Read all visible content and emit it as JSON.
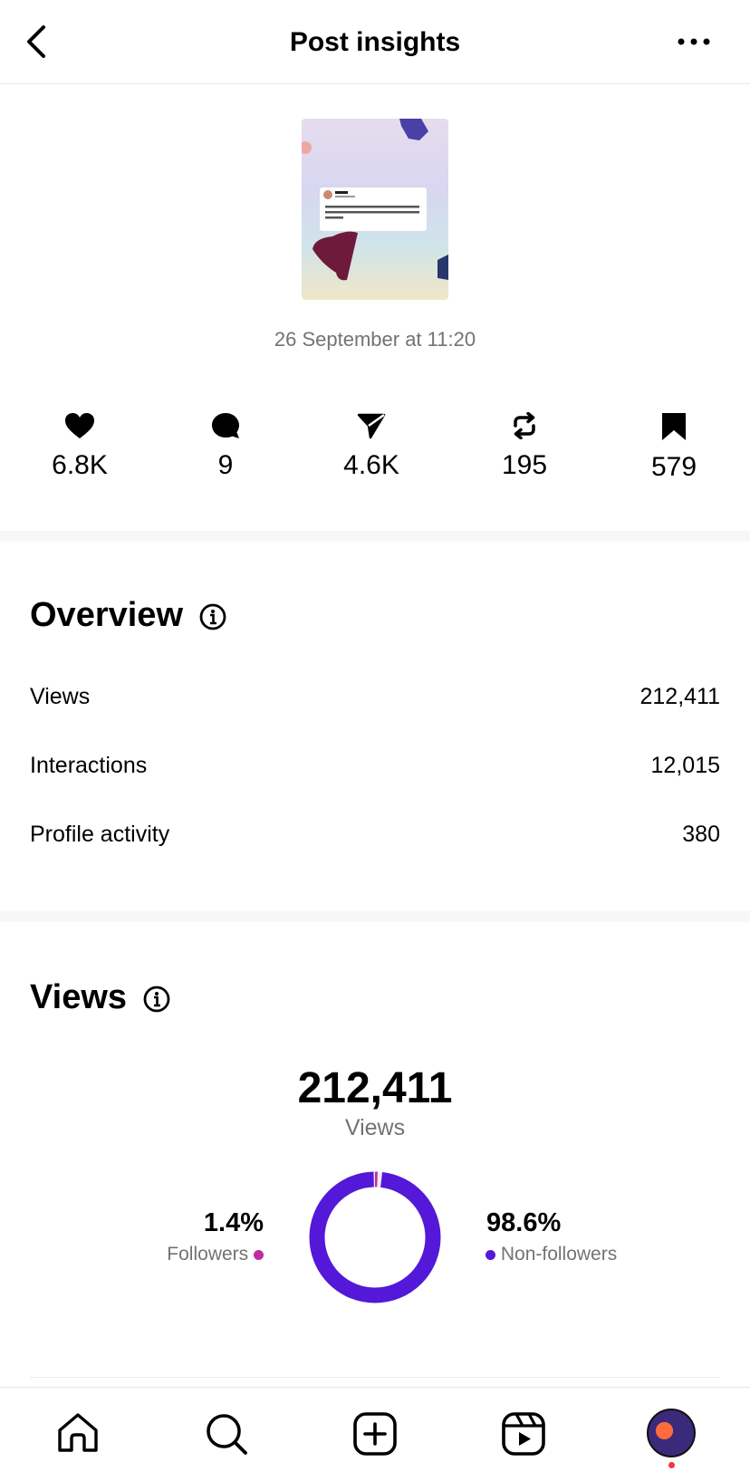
{
  "header": {
    "title": "Post insights"
  },
  "post": {
    "date": "26 September at 11:20"
  },
  "stats": [
    {
      "icon": "heart-icon",
      "value": "6.8K"
    },
    {
      "icon": "comment-icon",
      "value": "9"
    },
    {
      "icon": "share-icon",
      "value": "4.6K"
    },
    {
      "icon": "repost-icon",
      "value": "195"
    },
    {
      "icon": "bookmark-icon",
      "value": "579"
    }
  ],
  "overview": {
    "title": "Overview",
    "rows": [
      {
        "label": "Views",
        "value": "212,411"
      },
      {
        "label": "Interactions",
        "value": "12,015"
      },
      {
        "label": "Profile activity",
        "value": "380"
      }
    ]
  },
  "views": {
    "title": "Views",
    "total": "212,411",
    "total_label": "Views",
    "followers": {
      "percent": "1.4%",
      "label": "Followers",
      "fraction": 0.014,
      "color": "#c32aa3"
    },
    "non_followers": {
      "percent": "98.6%",
      "label": "Non-followers",
      "fraction": 0.986,
      "color": "#5418d8"
    }
  },
  "tabbar": [
    "home-icon",
    "search-icon",
    "create-icon",
    "reels-icon",
    "profile-avatar"
  ]
}
